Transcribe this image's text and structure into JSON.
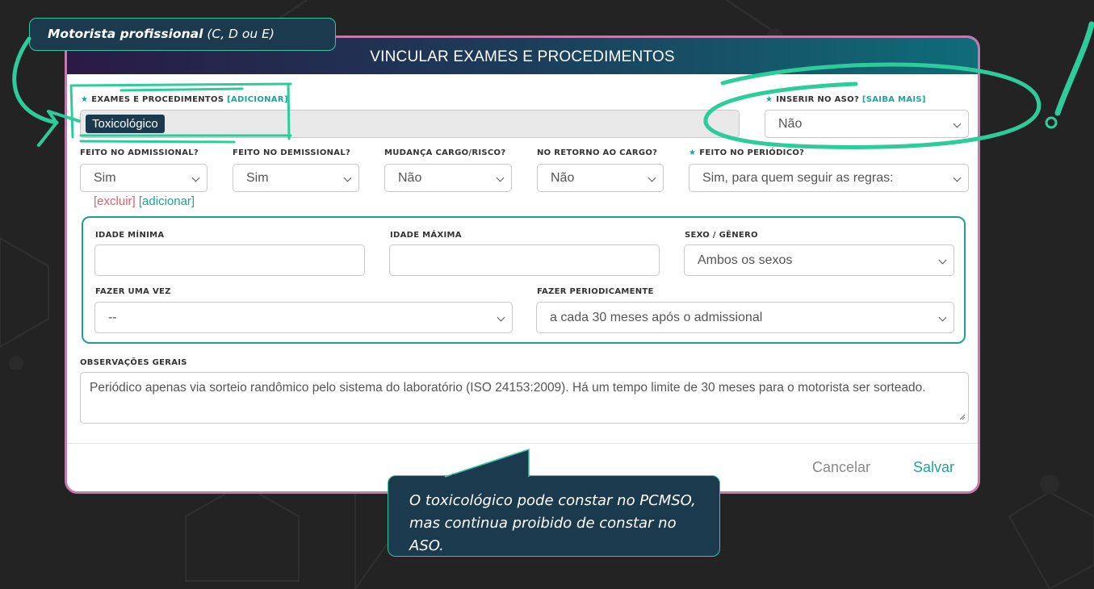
{
  "callout_top": {
    "bold": "Motorista profissional",
    "rest": " (C, D ou E)"
  },
  "modal": {
    "title": "VINCULAR EXAMES E PROCEDIMENTOS",
    "exams": {
      "label": "EXAMES E PROCEDIMENTOS",
      "link": "[ADICIONAR]",
      "tag": "Toxicológico"
    },
    "aso": {
      "label": "INSERIR NO ASO?",
      "link": "[SAIBA MAIS]",
      "value": "Não"
    },
    "row": [
      {
        "label": "FEITO NO ADMISSIONAL?",
        "value": "Sim"
      },
      {
        "label": "FEITO NO DEMISSIONAL?",
        "value": "Sim"
      },
      {
        "label": "MUDANÇA CARGO/RISCO?",
        "value": "Não"
      },
      {
        "label": "NO RETORNO AO CARGO?",
        "value": "Não"
      },
      {
        "label": "FEITO NO PERIÓDICO?",
        "value": "Sim, para quem seguir as regras:"
      }
    ],
    "links": {
      "delete": "excluir",
      "add": "adicionar"
    },
    "rules": {
      "min_age_label": "IDADE MÍNIMA",
      "max_age_label": "IDADE MÁXIMA",
      "sex_label": "SEXO / GÊNERO",
      "sex_value": "Ambos os sexos",
      "once_label": "FAZER UMA VEZ",
      "once_value": "--",
      "periodic_label": "FAZER PERIODICAMENTE",
      "periodic_value": "a cada 30 meses após o admissional"
    },
    "notes": {
      "label": "OBSERVAÇÕES GERAIS",
      "value": "Periódico apenas via sorteio randômico pelo sistema do laboratório (ISO 24153:2009). Há um tempo limite de 30 meses para o motorista ser sorteado."
    },
    "cancel": "Cancelar",
    "save": "Salvar"
  },
  "callout_bottom": "O toxicológico pode constar no PCMSO, mas continua proibido de constar no ASO.",
  "colors": {
    "accent": "#1aa69a",
    "callout_bg": "#1c3a4e",
    "callout_border": "#36c3a6",
    "highlight": "#2ecc9a",
    "modal_border": "#c27bb0",
    "danger": "#e25b6b"
  }
}
